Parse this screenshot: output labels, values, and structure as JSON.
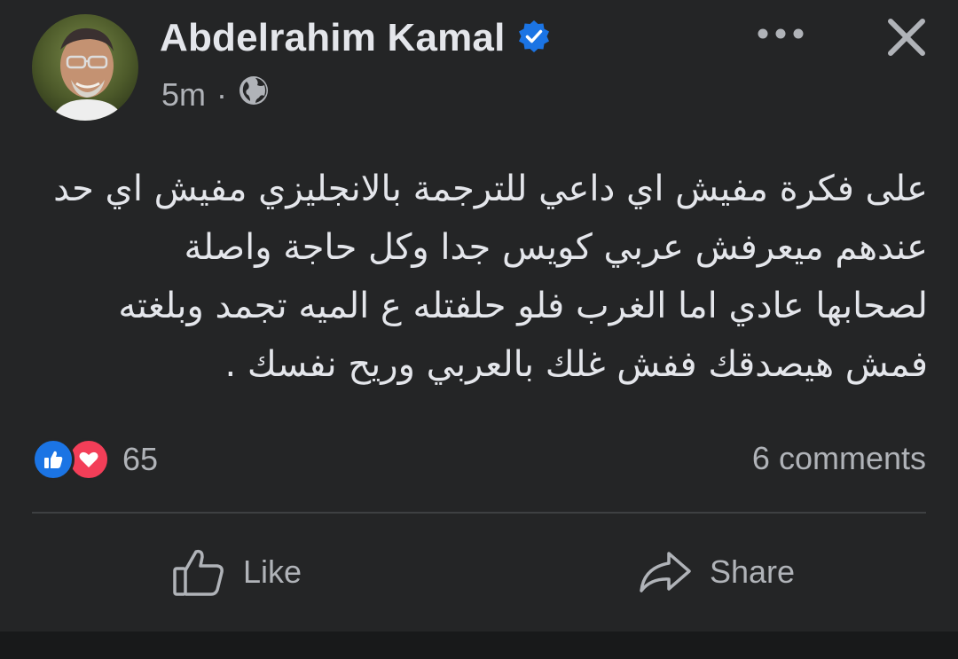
{
  "post": {
    "author": "Abdelrahim Kamal",
    "verified_icon": "verified-badge-icon",
    "time": "5m",
    "separator": "·",
    "audience_icon": "globe-icon",
    "body_lines": [
      "على فكرة مفيش اي داعي للترجمة بالانجليزي مفيش اي حد",
      "عندهم ميعرفش عربي كويس جدا وكل حاجة واصلة",
      "لصحابها عادي اما الغرب فلو حلفتله ع الميه تجمد وبلغته",
      "فمش هيصدقك ففش  غلك بالعربي وريح نفسك ."
    ]
  },
  "header_actions": {
    "more_icon": "more-horizontal-icon",
    "close_icon": "close-icon"
  },
  "stats": {
    "reaction_icons": [
      "like-reaction-icon",
      "love-reaction-icon"
    ],
    "reaction_count": "65",
    "comments": "6 comments"
  },
  "actions": {
    "like_label": "Like",
    "like_icon": "thumbs-up-icon",
    "share_label": "Share",
    "share_icon": "share-arrow-icon"
  },
  "colors": {
    "background": "#242526",
    "text_primary": "#e4e6eb",
    "text_secondary": "#b0b3b8",
    "verified": "#1b74e4",
    "like": "#1b74e4",
    "love": "#f33e58",
    "divider": "#3e4042"
  }
}
